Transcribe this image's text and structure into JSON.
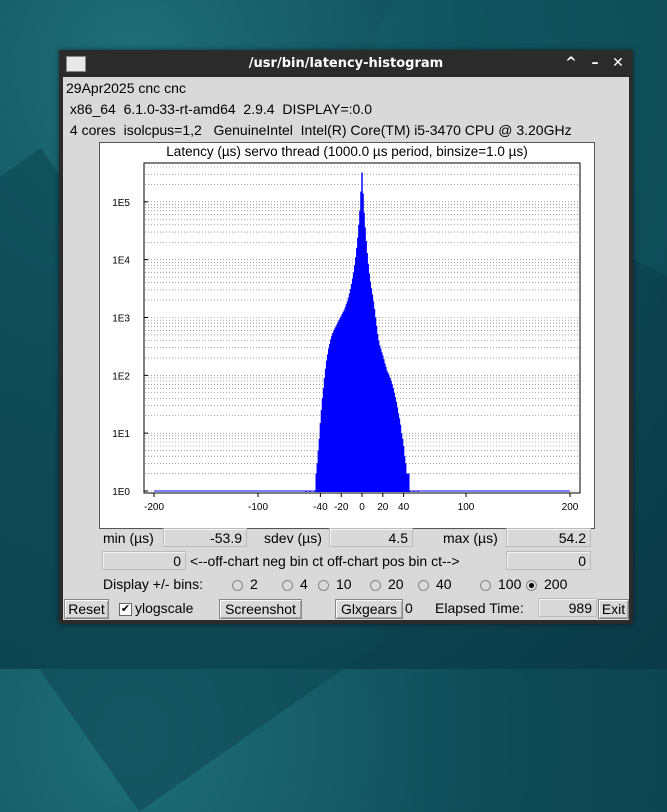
{
  "window": {
    "title": "/usr/bin/latency-histogram",
    "minimize": "–",
    "maximize": "^",
    "close": "✕"
  },
  "info": {
    "line1": "29Apr2025 cnc cnc",
    "line2": " x86_64  6.1.0-33-rt-amd64  2.9.4  DISPLAY=:0.0",
    "line3": " 4 cores  isolcpus=1,2   GenuineIntel  Intel(R) Core(TM) i5-3470 CPU @ 3.20GHz"
  },
  "chart_data": {
    "type": "bar",
    "title": "Latency (µs) servo thread (1000.0 µs period, binsize=1.0 µs)",
    "log_y": true,
    "xlim": [
      -200,
      200
    ],
    "ylim": [
      1,
      400000
    ],
    "x_ticks": [
      "-200",
      "-100",
      "-40",
      "-20",
      "0",
      "20",
      "40",
      "100",
      "200"
    ],
    "x_tick_values": [
      -200,
      -100,
      -40,
      -20,
      0,
      20,
      40,
      100,
      200
    ],
    "y_ticks": [
      "1E0",
      "1E1",
      "1E2",
      "1E3",
      "1E4",
      "1E5"
    ],
    "grid": true,
    "color": "#0000ff",
    "series": [
      {
        "values": [
          [
            -54,
            1
          ],
          [
            -50,
            1
          ],
          [
            -45,
            1
          ],
          [
            -44,
            2
          ],
          [
            -43,
            3
          ],
          [
            -42,
            5
          ],
          [
            -41,
            8
          ],
          [
            -40,
            15
          ],
          [
            -39,
            25
          ],
          [
            -38,
            40
          ],
          [
            -37,
            60
          ],
          [
            -36,
            90
          ],
          [
            -35,
            130
          ],
          [
            -34,
            180
          ],
          [
            -33,
            230
          ],
          [
            -32,
            290
          ],
          [
            -31,
            350
          ],
          [
            -30,
            420
          ],
          [
            -29,
            480
          ],
          [
            -28,
            540
          ],
          [
            -27,
            600
          ],
          [
            -26,
            650
          ],
          [
            -25,
            700
          ],
          [
            -24,
            760
          ],
          [
            -23,
            830
          ],
          [
            -22,
            900
          ],
          [
            -21,
            980
          ],
          [
            -20,
            1050
          ],
          [
            -19,
            1150
          ],
          [
            -18,
            1250
          ],
          [
            -17,
            1350
          ],
          [
            -16,
            1500
          ],
          [
            -15,
            1700
          ],
          [
            -14,
            1900
          ],
          [
            -13,
            2200
          ],
          [
            -12,
            2600
          ],
          [
            -11,
            3100
          ],
          [
            -10,
            3800
          ],
          [
            -9,
            4700
          ],
          [
            -8,
            6000
          ],
          [
            -7,
            8000
          ],
          [
            -6,
            11000
          ],
          [
            -5,
            16000
          ],
          [
            -4,
            24000
          ],
          [
            -3,
            40000
          ],
          [
            -2,
            70000
          ],
          [
            -1,
            150000
          ],
          [
            0,
            320000
          ],
          [
            1,
            140000
          ],
          [
            2,
            65000
          ],
          [
            3,
            36000
          ],
          [
            4,
            21000
          ],
          [
            5,
            13000
          ],
          [
            6,
            8500
          ],
          [
            7,
            5800
          ],
          [
            8,
            4200
          ],
          [
            9,
            3200
          ],
          [
            10,
            2500
          ],
          [
            11,
            1900
          ],
          [
            12,
            1400
          ],
          [
            13,
            1000
          ],
          [
            14,
            720
          ],
          [
            15,
            520
          ],
          [
            16,
            400
          ],
          [
            17,
            330
          ],
          [
            18,
            290
          ],
          [
            19,
            250
          ],
          [
            20,
            220
          ],
          [
            21,
            190
          ],
          [
            22,
            160
          ],
          [
            23,
            140
          ],
          [
            24,
            120
          ],
          [
            25,
            110
          ],
          [
            26,
            100
          ],
          [
            27,
            90
          ],
          [
            28,
            80
          ],
          [
            29,
            70
          ],
          [
            30,
            60
          ],
          [
            31,
            50
          ],
          [
            32,
            42
          ],
          [
            33,
            35
          ],
          [
            34,
            28
          ],
          [
            35,
            22
          ],
          [
            36,
            18
          ],
          [
            37,
            14
          ],
          [
            38,
            10
          ],
          [
            39,
            8
          ],
          [
            40,
            6
          ],
          [
            41,
            4
          ],
          [
            42,
            3
          ],
          [
            43,
            2
          ],
          [
            44,
            2
          ],
          [
            45,
            2
          ],
          [
            46,
            1
          ],
          [
            50,
            1
          ],
          [
            54,
            1
          ]
        ]
      }
    ]
  },
  "stats": {
    "min_label": "min (µs)",
    "min_value": "-53.9",
    "sdev_label": "sdev (µs)",
    "sdev_value": "4.5",
    "max_label": "max (µs)",
    "max_value": "54.2",
    "neg_off_chart": "0",
    "offchart_label": "<--off-chart neg bin ct off-chart pos bin ct-->",
    "pos_off_chart": "0"
  },
  "bins": {
    "label": "Display +/- bins:",
    "options": [
      "2",
      "4",
      "10",
      "20",
      "40",
      "100",
      "200"
    ],
    "selected": "200"
  },
  "bottom": {
    "reset": "Reset",
    "ylogscale": "ylogscale",
    "ylogscale_checked": true,
    "screenshot": "Screenshot",
    "glxgears": "Glxgears",
    "glxgears_count": "0",
    "elapsed_label": "Elapsed Time:",
    "elapsed_value": "989",
    "exit": "Exit"
  }
}
